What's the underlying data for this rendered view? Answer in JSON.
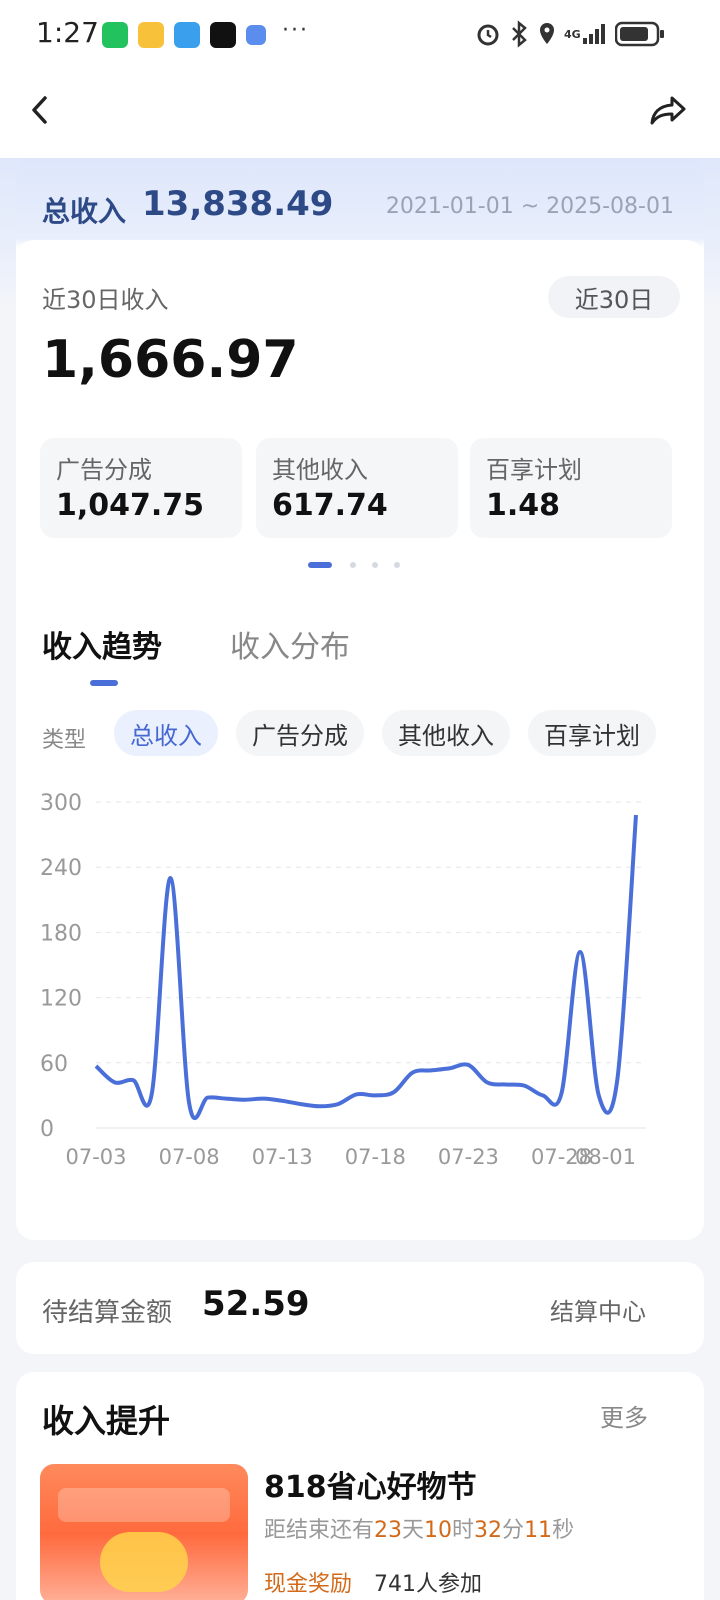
{
  "status_bar": {
    "time": "1:27",
    "dots": "···",
    "network": "4G"
  },
  "nav": {
    "back_icon": "chevron-left-icon",
    "share_icon": "share-arrow-icon"
  },
  "summary": {
    "total_label": "总收入",
    "total_value": "13,838.49",
    "date_range": "2021-01-01 ~ 2025-08-01",
    "recent_label": "近30日收入",
    "recent_value": "1,666.97",
    "period_selector": "近30日",
    "breakdown": [
      {
        "label": "广告分成",
        "value": "1,047.75"
      },
      {
        "label": "其他收入",
        "value": "617.74"
      },
      {
        "label": "百享计划",
        "value": "1.48"
      }
    ]
  },
  "tabs": [
    {
      "label": "收入趋势",
      "active": true
    },
    {
      "label": "收入分布",
      "active": false
    }
  ],
  "filter": {
    "label": "类型",
    "chips": [
      {
        "label": "总收入",
        "active": true
      },
      {
        "label": "广告分成",
        "active": false
      },
      {
        "label": "其他收入",
        "active": false
      },
      {
        "label": "百享计划",
        "active": false
      }
    ]
  },
  "chart_data": {
    "type": "line",
    "x": [
      "07-03",
      "07-04",
      "07-05",
      "07-06",
      "07-07",
      "07-08",
      "07-09",
      "07-10",
      "07-11",
      "07-12",
      "07-13",
      "07-14",
      "07-15",
      "07-16",
      "07-17",
      "07-18",
      "07-19",
      "07-20",
      "07-21",
      "07-22",
      "07-23",
      "07-24",
      "07-25",
      "07-26",
      "07-27",
      "07-28",
      "07-29",
      "07-30",
      "07-31",
      "08-01"
    ],
    "x_tick_labels": [
      "07-03",
      "07-08",
      "07-13",
      "07-18",
      "07-23",
      "07-28",
      "08-01"
    ],
    "values": [
      57,
      42,
      44,
      32,
      230,
      23,
      28,
      27,
      26,
      27,
      25,
      22,
      20,
      22,
      31,
      30,
      33,
      51,
      53,
      55,
      58,
      42,
      40,
      39,
      30,
      32,
      162,
      30,
      45,
      288
    ],
    "ylim": [
      0,
      300
    ],
    "yticks": [
      0,
      60,
      120,
      180,
      240,
      300
    ],
    "grid": true,
    "line_color": "#4a6fd8"
  },
  "pending": {
    "label": "待结算金额",
    "value": "52.59",
    "link": "结算中心"
  },
  "boost": {
    "title": "收入提升",
    "more": "更多",
    "promo": {
      "title": "818省心好物节",
      "countdown_prefix": "距结束还有",
      "days": "23",
      "days_unit": "天",
      "hours": "10",
      "hours_unit": "时",
      "minutes": "32",
      "minutes_unit": "分",
      "seconds": "11",
      "seconds_unit": "秒",
      "tag": "现金奖励",
      "participants": "741人参加"
    }
  }
}
